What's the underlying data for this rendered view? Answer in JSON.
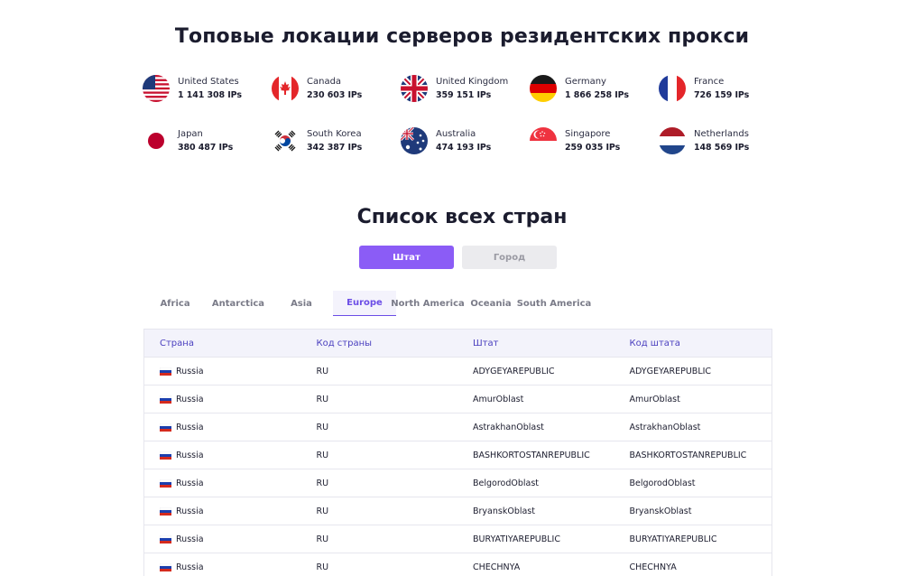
{
  "top_title": "Топовые локации серверов резидентских прокси",
  "locations": [
    {
      "name": "United States",
      "ips": "1 141 308 IPs",
      "flag": "us-flag-icon"
    },
    {
      "name": "Canada",
      "ips": "230 603 IPs",
      "flag": "ca-flag-icon"
    },
    {
      "name": "United Kingdom",
      "ips": "359 151 IPs",
      "flag": "gb-flag-icon"
    },
    {
      "name": "Germany",
      "ips": "1 866 258 IPs",
      "flag": "de-flag-icon"
    },
    {
      "name": "France",
      "ips": "726 159 IPs",
      "flag": "fr-flag-icon"
    },
    {
      "name": "Japan",
      "ips": "380 487 IPs",
      "flag": "jp-flag-icon"
    },
    {
      "name": "South Korea",
      "ips": "342 387 IPs",
      "flag": "kr-flag-icon"
    },
    {
      "name": "Australia",
      "ips": "474 193 IPs",
      "flag": "au-flag-icon"
    },
    {
      "name": "Singapore",
      "ips": "259 035 IPs",
      "flag": "sg-flag-icon"
    },
    {
      "name": "Netherlands",
      "ips": "148 569 IPs",
      "flag": "nl-flag-icon"
    }
  ],
  "list_title": "Список всех стран",
  "toggles": {
    "state": "Штат",
    "city": "Город",
    "active": "state"
  },
  "tabs": [
    "Africa",
    "Antarctica",
    "Asia",
    "Europe",
    "North America",
    "Oceania",
    "South America"
  ],
  "active_tab": "Europe",
  "table": {
    "headers": [
      "Страна",
      "Код страны",
      "Штат",
      "Код штата"
    ],
    "rows": [
      [
        "Russia",
        "RU",
        "ADYGEYAREPUBLIC",
        "ADYGEYAREPUBLIC"
      ],
      [
        "Russia",
        "RU",
        "AmurOblast",
        "AmurOblast"
      ],
      [
        "Russia",
        "RU",
        "AstrakhanOblast",
        "AstrakhanOblast"
      ],
      [
        "Russia",
        "RU",
        "BASHKORTOSTANREPUBLIC",
        "BASHKORTOSTANREPUBLIC"
      ],
      [
        "Russia",
        "RU",
        "BelgorodOblast",
        "BelgorodOblast"
      ],
      [
        "Russia",
        "RU",
        "BryanskOblast",
        "BryanskOblast"
      ],
      [
        "Russia",
        "RU",
        "BURYATIYAREPUBLIC",
        "BURYATIYAREPUBLIC"
      ],
      [
        "Russia",
        "RU",
        "CHECHNYA",
        "CHECHNYA"
      ]
    ]
  },
  "colors": {
    "accent": "#8b5cf6",
    "tab_active": "#6b4de6",
    "header_text": "#4a3fbf"
  }
}
